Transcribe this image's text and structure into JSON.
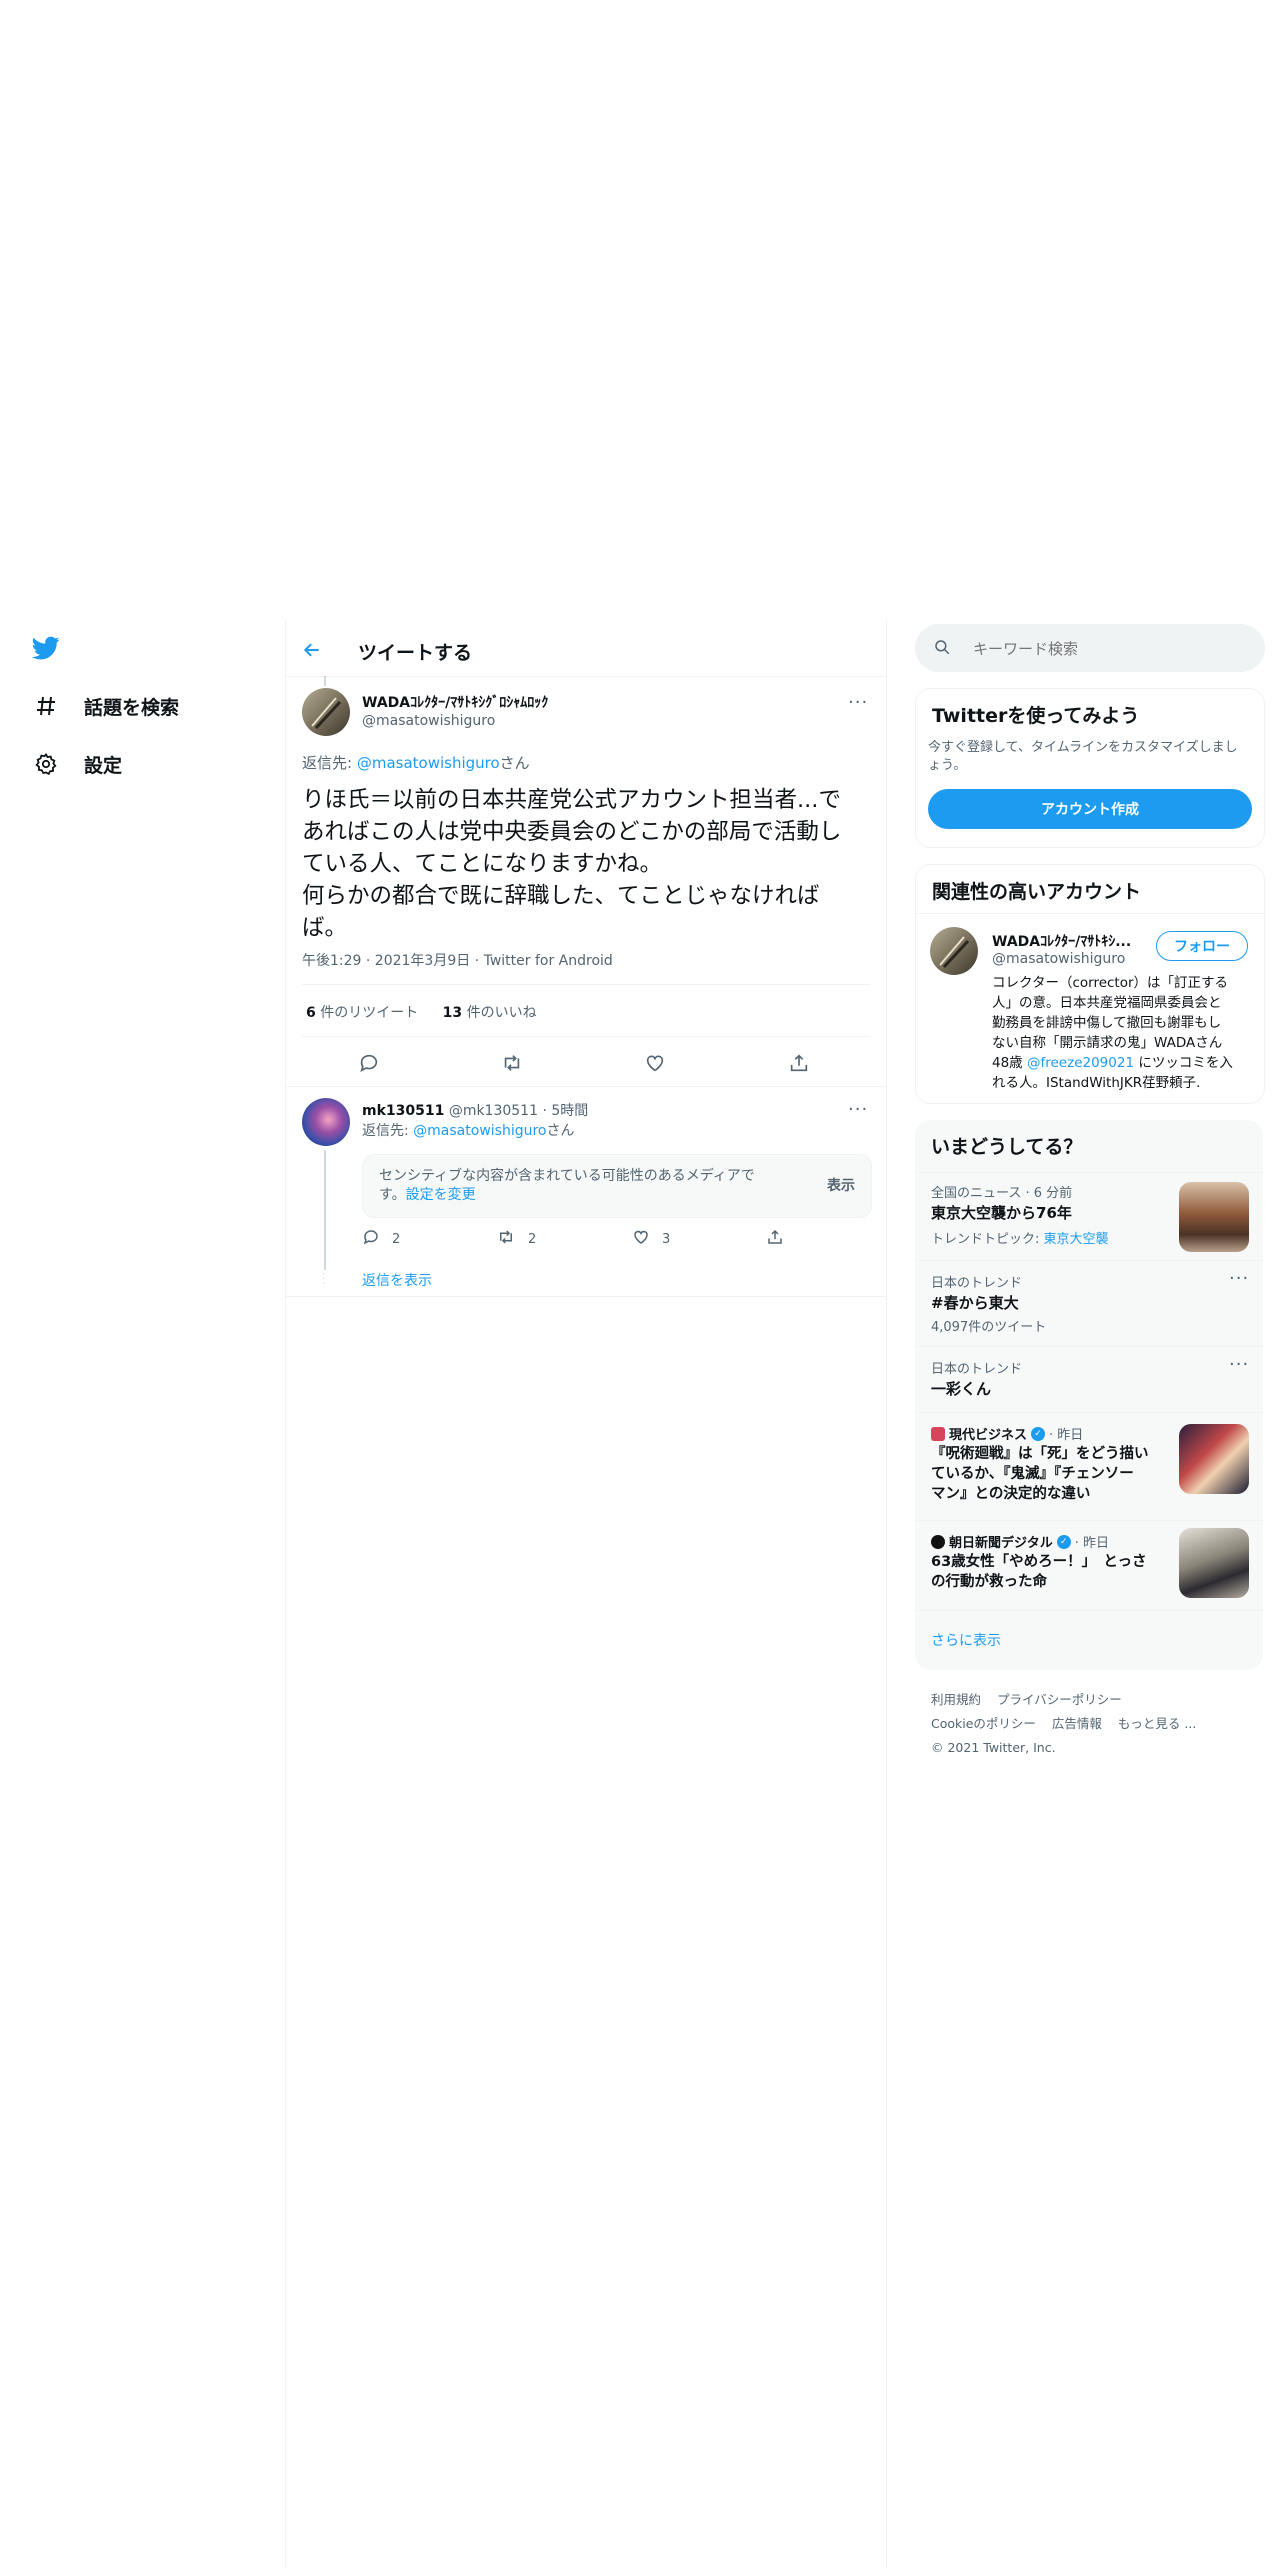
{
  "nav": {
    "explore_label": "話題を検索",
    "settings_label": "設定"
  },
  "header": {
    "title": "ツイートする"
  },
  "tweet": {
    "display_name": "WADAｺﾚｸﾀｰ/ﾏｻﾄｷｼｸﾞﾛｼｬﾑﾛｯｸ",
    "handle": "@masatowishiguro",
    "reply_prefix": "返信先: ",
    "reply_to": "@masatowishiguro",
    "reply_suffix": "さん",
    "text_lines": [
      "りほ氏＝以前の日本共産党公式アカウント担当者...で",
      "あればこの人は党中央委員会のどこかの部局で活動し",
      "ている人、てことになりますかね。",
      "何らかの都合で既に辞職した、てことじゃなければ",
      "ば。"
    ],
    "meta": "午後1:29 · 2021年3月9日 · Twitter for Android",
    "retweets_count": "6",
    "retweets_label": " 件のリツイート",
    "likes_count": "13",
    "likes_label": " 件のいいね"
  },
  "reply": {
    "display_name": "mk130511",
    "handle": "@mk130511",
    "time": "· 5時間",
    "reply_prefix": "返信先: ",
    "reply_to": "@masatowishiguro",
    "reply_suffix": "さん",
    "sensitive_text": "センシティブな内容が含まれている可能性のあるメディアで",
    "sensitive_text2": "す。",
    "settings_link": "設定を変更",
    "show_button": "表示",
    "reply_count": "2",
    "retweet_count": "2",
    "like_count": "3",
    "show_replies": "返信を表示"
  },
  "search": {
    "placeholder": "キーワード検索"
  },
  "signup": {
    "title": "Twitterを使ってみよう",
    "desc_line1": "今すぐ登録して、タイムラインをカスタマイズしまし",
    "desc_line2": "ょう。",
    "button": "アカウント作成"
  },
  "relevant": {
    "title": "関連性の高いアカウント",
    "name": "WADAｺﾚｸﾀｰ/ﾏｻﾄｷｼ...",
    "handle": "@masatowishiguro",
    "follow": "フォロー",
    "bio_lines": [
      "コレクター（corrector）は「訂正する",
      "人」の意。日本共産党福岡県委員会と",
      "勤務員を誹謗中傷して撤回も謝罪もし",
      "ない自称「開示請求の鬼」WADAさん",
      "48歳"
    ],
    "bio_mention": "@freeze209021",
    "bio_tail": " にツッコミを入",
    "bio_last": "れる人。IStandWithJKR荏野頼子."
  },
  "trends": {
    "title": "いまどうしてる？",
    "items": [
      {
        "context": "全国のニュース · 6 分前",
        "title": "東京大空襲から76年",
        "sub_prefix": "トレンドトピック: ",
        "sub_link": "東京大空襲"
      },
      {
        "context": "日本のトレンド",
        "title": "#春から東大",
        "count": "4,097件のツイート"
      },
      {
        "context": "日本のトレンド",
        "title": "一彩くん"
      },
      {
        "source": "現代ビジネス",
        "time": "· 昨日",
        "title_lines": [
          "『呪術廻戦』は「死」をどう描い",
          "ているか、『鬼滅』『チェンソー",
          "マン』との決定的な違い"
        ]
      },
      {
        "source": "朝日新聞デジタル",
        "time": "· 昨日",
        "title_lines": [
          "63歳女性「やめろー！」　とっさ",
          "の行動が救った命"
        ]
      }
    ],
    "show_more": "さらに表示"
  },
  "footer": {
    "terms": "利用規約",
    "privacy": "プライバシーポリシー",
    "cookie": "Cookieのポリシー",
    "ads": "広告情報",
    "more": "もっと見る ...",
    "copyright": "© 2021 Twitter, Inc."
  },
  "colors": {
    "accent": "#1d9bf0",
    "text": "#0f1419",
    "muted": "#536471",
    "border": "#eff3f4",
    "panel": "#f7f9f9"
  }
}
